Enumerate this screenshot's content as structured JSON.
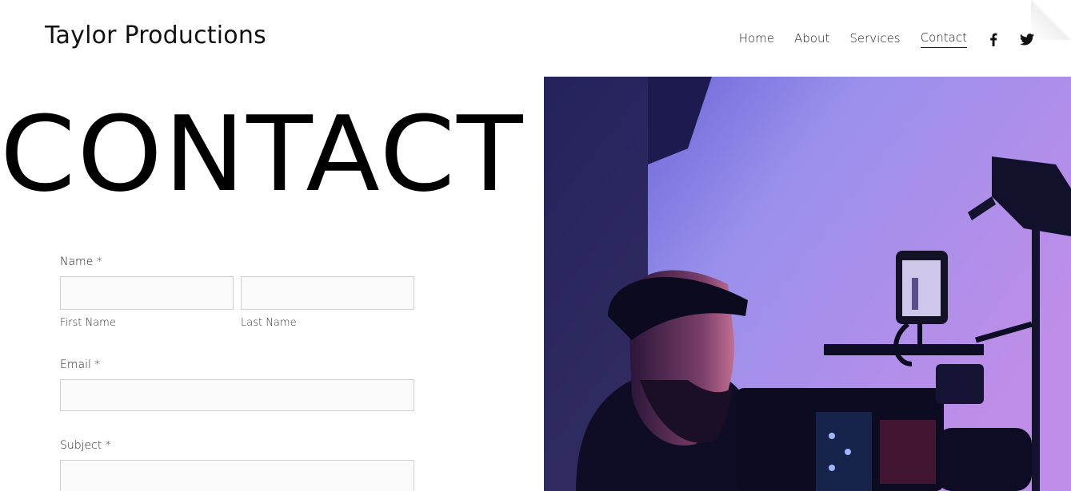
{
  "site": {
    "title": "Taylor Productions"
  },
  "nav": {
    "items": [
      {
        "label": "Home"
      },
      {
        "label": "About"
      },
      {
        "label": "Services"
      },
      {
        "label": "Contact",
        "active": true
      }
    ],
    "social": [
      "facebook-icon",
      "twitter-icon"
    ]
  },
  "hero": {
    "title": "CONTACT"
  },
  "form": {
    "name": {
      "label": "Name *",
      "first_label": "First Name",
      "last_label": "Last Name",
      "first_value": "",
      "last_value": ""
    },
    "email": {
      "label": "Email *",
      "value": ""
    },
    "subject": {
      "label": "Subject *",
      "value": ""
    }
  },
  "colors": {
    "accent": "#111111",
    "input_bg": "#fafafa",
    "input_border": "#cfcfcf",
    "photo_tint": "#8f86e6"
  }
}
